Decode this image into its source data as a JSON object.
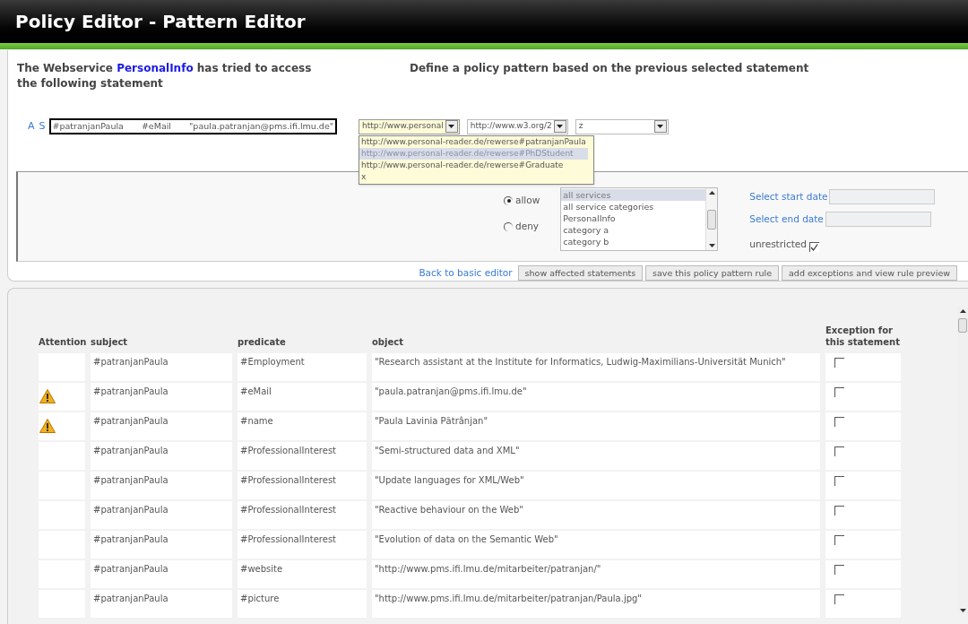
{
  "window": {
    "title": "Policy Editor - Pattern Editor"
  },
  "intro": {
    "before": "The Webservice",
    "service": "PersonalInfo",
    "after": "has tried to access the following statement"
  },
  "pattern_heading": "Define a policy pattern based on the previous selected statement",
  "statement": {
    "markers": [
      "A",
      "S"
    ],
    "subject": "#patranjanPaula",
    "predicate": "#eMail",
    "object": "\"paula.patranjan@pms.ifi.lmu.de\""
  },
  "pattern_selects": [
    {
      "value": "http://www.personal",
      "expanded": true,
      "options": [
        {
          "label": "http://www.personal-reader.de/rewerse#patranjanPaula",
          "selected": false
        },
        {
          "label": "http://www.personal-reader.de/rewerse#PhDStudent",
          "selected": true
        },
        {
          "label": "http://www.personal-reader.de/rewerse#Graduate",
          "selected": false
        },
        {
          "label": "x",
          "selected": false
        }
      ]
    },
    {
      "value": "http://www.w3.org/2",
      "expanded": false
    },
    {
      "value": "z",
      "expanded": false
    }
  ],
  "access": [
    {
      "label": "allow",
      "selected": true
    },
    {
      "label": "deny",
      "selected": false
    }
  ],
  "services": [
    {
      "label": "all services",
      "selected": true
    },
    {
      "label": "all service categories",
      "selected": false
    },
    {
      "label": "PersonalInfo",
      "selected": false
    },
    {
      "label": "category a",
      "selected": false
    },
    {
      "label": "category b",
      "selected": false
    }
  ],
  "dates": {
    "start": "Select start date",
    "end": "Select end date",
    "unrestricted": {
      "label": "unrestricted",
      "checked": true
    }
  },
  "actions": {
    "back_link": "Back to basic editor",
    "buttons": [
      "show affected statements",
      "save this policy pattern rule",
      "add exceptions and view rule preview"
    ]
  },
  "table": {
    "columns": [
      "Attention",
      "subject",
      "predicate",
      "object",
      "Exception for this statement"
    ],
    "rows": [
      {
        "attention": false,
        "subject": "#patranjanPaula",
        "predicate": "#Employment",
        "object": "\"Research assistant at the Institute for Informatics, Ludwig-Maximilians-Universität Munich\"",
        "exception": false
      },
      {
        "attention": true,
        "subject": "#patranjanPaula",
        "predicate": "#eMail",
        "object": "\"paula.patranjan@pms.ifi.lmu.de\"",
        "exception": false
      },
      {
        "attention": true,
        "subject": "#patranjanPaula",
        "predicate": "#name",
        "object": "\"Paula Lavinia Pătrânjan\"",
        "exception": false
      },
      {
        "attention": false,
        "subject": "#patranjanPaula",
        "predicate": "#ProfessionalInterest",
        "object": "\"Semi-structured data and XML\"",
        "exception": false
      },
      {
        "attention": false,
        "subject": "#patranjanPaula",
        "predicate": "#ProfessionalInterest",
        "object": "\"Update languages for XML/Web\"",
        "exception": false
      },
      {
        "attention": false,
        "subject": "#patranjanPaula",
        "predicate": "#ProfessionalInterest",
        "object": "\"Reactive behaviour on the Web\"",
        "exception": false
      },
      {
        "attention": false,
        "subject": "#patranjanPaula",
        "predicate": "#ProfessionalInterest",
        "object": "\"Evolution of data on the Semantic Web\"",
        "exception": false
      },
      {
        "attention": false,
        "subject": "#patranjanPaula",
        "predicate": "#website",
        "object": "\"http://www.pms.ifi.lmu.de/mitarbeiter/patranjan/\"",
        "exception": false
      },
      {
        "attention": false,
        "subject": "#patranjanPaula",
        "predicate": "#picture",
        "object": "\"http://www.pms.ifi.lmu.de/mitarbeiter/patranjan/Paula.jpg\"",
        "exception": false
      }
    ]
  }
}
